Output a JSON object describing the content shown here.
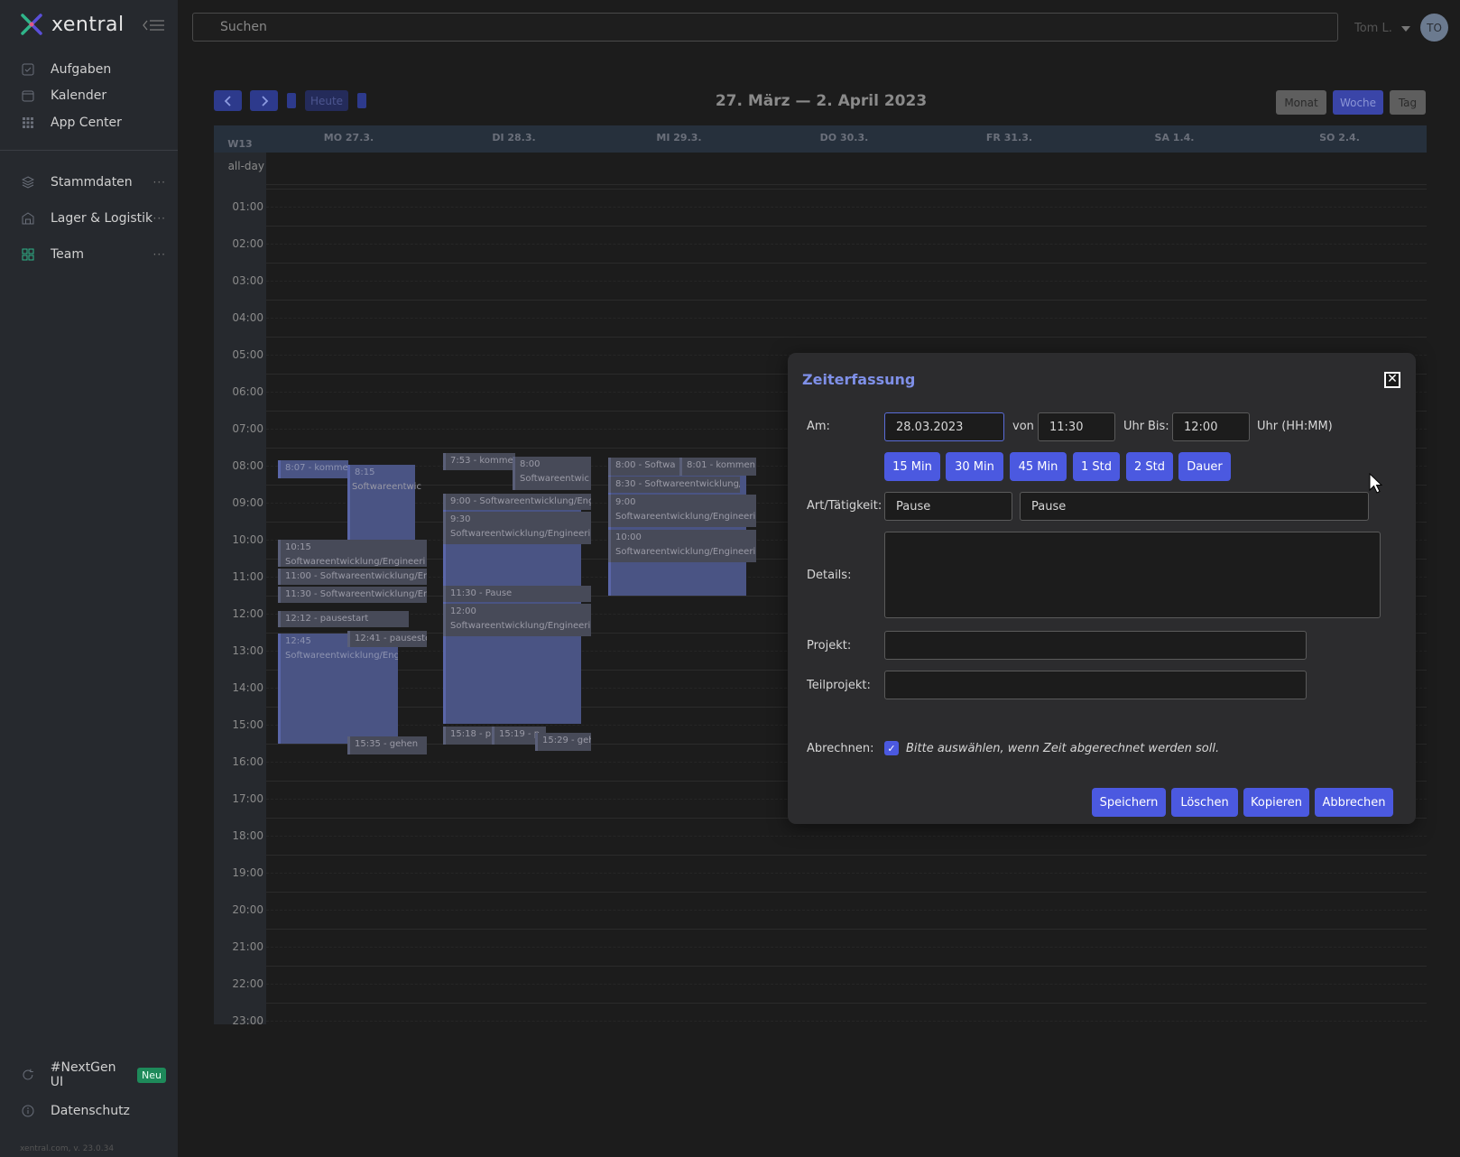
{
  "app": {
    "brand": "xentral",
    "version": "xentral.com, v. 23.0.34"
  },
  "sidebar": {
    "items": [
      {
        "label": "Aufgaben",
        "icon": "check-icon"
      },
      {
        "label": "Kalender",
        "icon": "calendar-icon"
      },
      {
        "label": "App Center",
        "icon": "grid-icon"
      },
      {
        "label": "Stammdaten",
        "icon": "layers-icon",
        "more": "···"
      },
      {
        "label": "Lager & Logistik",
        "icon": "warehouse-icon",
        "more": "···"
      },
      {
        "label": "Team",
        "icon": "team-icon",
        "more": "···"
      }
    ],
    "bottom": [
      {
        "label": "#NextGen UI",
        "badge": "Neu"
      },
      {
        "label": "Datenschutz"
      }
    ]
  },
  "topbar": {
    "search_placeholder": "Suchen",
    "user_name": "Tom L.",
    "avatar": "TO"
  },
  "calendar": {
    "title": "27. März — 2. April 2023",
    "today_label": "Heute",
    "views": {
      "month": "Monat",
      "week": "Woche",
      "day": "Tag"
    },
    "week_label": "W13",
    "allday_label": "all-day",
    "days": [
      "MO 27.3.",
      "DI 28.3.",
      "MI 29.3.",
      "DO 30.3.",
      "FR 31.3.",
      "SA 1.4.",
      "SO 2.4."
    ],
    "hours": [
      "01:00",
      "02:00",
      "03:00",
      "04:00",
      "05:00",
      "06:00",
      "07:00",
      "08:00",
      "09:00",
      "10:00",
      "11:00",
      "12:00",
      "13:00",
      "14:00",
      "15:00",
      "16:00",
      "17:00",
      "18:00",
      "19:00",
      "20:00",
      "21:00",
      "22:00",
      "23:00"
    ],
    "events": {
      "e1": "8:07 - komme",
      "e2_time": "8:15",
      "e2_title": "Softwareentwic",
      "e3_time": "10:15",
      "e3_title": "Softwareentwicklung/Engineeri",
      "e4": "11:00 - Softwareentwicklung/Eng",
      "e5": "11:30 - Softwareentwicklung/Eng",
      "e6": "12:12 - pausestart",
      "e7_time": "12:45",
      "e7_title": "Softwareentwicklung/Engin",
      "e8": "12:41 - pausesto",
      "e9": "15:35 - gehen",
      "d1": "7:53 - komme",
      "d2_time": "8:00",
      "d2_title": "Softwareentwic",
      "d3": "9:00 - Softwareentwicklung/Eng",
      "d4_time": "9:30",
      "d4_title": "Softwareentwicklung/Engineeri",
      "d5": "11:30 - Pause",
      "d6_time": "12:00",
      "d6_title": "Softwareentwicklung/Engineeri",
      "d7": "15:18 - p",
      "d8": "15:19 - p",
      "d9": "15:29 - geh",
      "m1": "8:00 - Softwa",
      "m2": "8:01 - kommen",
      "m3": "8:30 - Softwareentwicklung/",
      "m4_time": "9:00",
      "m4_title": "Softwareentwicklung/Engineeri",
      "m5_time": "10:00",
      "m5_title": "Softwareentwicklung/Engineeri"
    }
  },
  "modal": {
    "title": "Zeiterfassung",
    "am_label": "Am:",
    "date": "28.03.2023",
    "von_label": "von",
    "von": "11:30",
    "uhr_label": "Uhr",
    "bis_label": "Bis:",
    "bis": "12:00",
    "format_label": "Uhr (HH:MM)",
    "durations": [
      "15 Min",
      "30 Min",
      "45 Min",
      "1 Std",
      "2 Std",
      "Dauer"
    ],
    "art_label": "Art/Tätigkeit:",
    "art_value": "Pause",
    "art_detail": "Pause",
    "details_label": "Details:",
    "projekt_label": "Projekt:",
    "teilprojekt_label": "Teilprojekt:",
    "abrechnen_label": "Abrechnen:",
    "abrechnen_text": "Bitte auswählen, wenn Zeit abgerechnet werden soll.",
    "buttons": {
      "save": "Speichern",
      "delete": "Löschen",
      "copy": "Kopieren",
      "cancel": "Abbrechen"
    }
  }
}
